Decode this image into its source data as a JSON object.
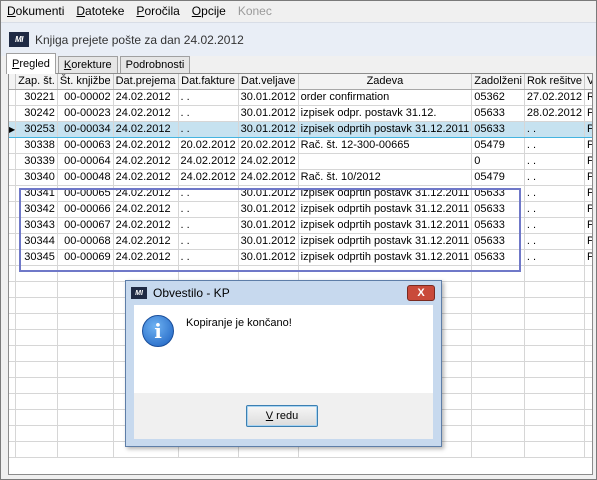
{
  "menu": [
    {
      "label": "Dokumenti",
      "u": "D",
      "rest": "okumenti",
      "disabled": false
    },
    {
      "label": "Datoteke",
      "u": "D",
      "rest": "atoteke",
      "disabled": false
    },
    {
      "label": "Poročila",
      "u": "P",
      "rest": "oročila",
      "disabled": false
    },
    {
      "label": "Opcije",
      "u": "O",
      "rest": "pcije",
      "disabled": false
    },
    {
      "label": "Konec",
      "u": "",
      "rest": "Konec",
      "disabled": true
    }
  ],
  "header": {
    "logo": "MI",
    "title": "Knjiga prejete pošte za dan 24.02.2012"
  },
  "tabs": [
    {
      "label": "Pregled",
      "u": "P",
      "rest": "regled",
      "active": true
    },
    {
      "label": "Korekture",
      "u": "K",
      "rest": "orekture",
      "active": false
    },
    {
      "label": "Podrobnosti",
      "u": "",
      "rest": "Podrobnosti",
      "active": false
    }
  ],
  "table": {
    "columns": [
      "Zap. št.",
      "Št. knjižbe",
      "Dat.prejema",
      "Dat.fakture",
      "Dat.veljave",
      "Zadeva",
      "Zadolženi",
      "Rok rešitve",
      "Vr"
    ],
    "rows": [
      [
        "30221",
        "00-00002",
        "24.02.2012",
        ". .",
        "30.01.2012",
        "order confirmation",
        "05362",
        "27.02.2012",
        "R"
      ],
      [
        "30242",
        "00-00023",
        "24.02.2012",
        ". .",
        "30.01.2012",
        "izpisek odpr. postavk 31.12.",
        "05633",
        "28.02.2012",
        "P"
      ],
      [
        "30253",
        "00-00034",
        "24.02.2012",
        ". .",
        "30.01.2012",
        "izpisek odprtih postavk 31.12.2011",
        "05633",
        ". .",
        "P"
      ],
      [
        "30338",
        "00-00063",
        "24.02.2012",
        "20.02.2012",
        "20.02.2012",
        "Rač. št. 12-300-00665",
        "05479",
        ". .",
        "P"
      ],
      [
        "30339",
        "00-00064",
        "24.02.2012",
        "24.02.2012",
        "24.02.2012",
        "",
        "0",
        ". .",
        "P"
      ],
      [
        "30340",
        "00-00048",
        "24.02.2012",
        "24.02.2012",
        "24.02.2012",
        "Rač. št. 10/2012",
        "05479",
        ". .",
        "P"
      ],
      [
        "30341",
        "00-00065",
        "24.02.2012",
        ". .",
        "30.01.2012",
        "izpisek odprtih postavk 31.12.2011",
        "05633",
        ". .",
        "P"
      ],
      [
        "30342",
        "00-00066",
        "24.02.2012",
        ". .",
        "30.01.2012",
        "izpisek odprtih postavk 31.12.2011",
        "05633",
        ". .",
        "P"
      ],
      [
        "30343",
        "00-00067",
        "24.02.2012",
        ". .",
        "30.01.2012",
        "izpisek odprtih postavk 31.12.2011",
        "05633",
        ". .",
        "P"
      ],
      [
        "30344",
        "00-00068",
        "24.02.2012",
        ". .",
        "30.01.2012",
        "izpisek odprtih postavk 31.12.2011",
        "05633",
        ". .",
        "P"
      ],
      [
        "30345",
        "00-00069",
        "24.02.2012",
        ". .",
        "30.01.2012",
        "izpisek odprtih postavk 31.12.2011",
        "05633",
        ". .",
        "P"
      ]
    ],
    "selected_row_index": 2,
    "row_indicator": "▶"
  },
  "dialog": {
    "logo": "MI",
    "title": "Obvestilo - KP",
    "close_label": "X",
    "icon": "info-icon",
    "icon_glyph": "i",
    "message": "Kopiranje je končano!",
    "ok_label": "V redu",
    "ok_u": "V",
    "ok_rest": " redu"
  },
  "colors": {
    "selection_row": "#c6e2f0",
    "selection_rect": "#6f78c8",
    "dialog_frame": "#c7d9ee"
  }
}
